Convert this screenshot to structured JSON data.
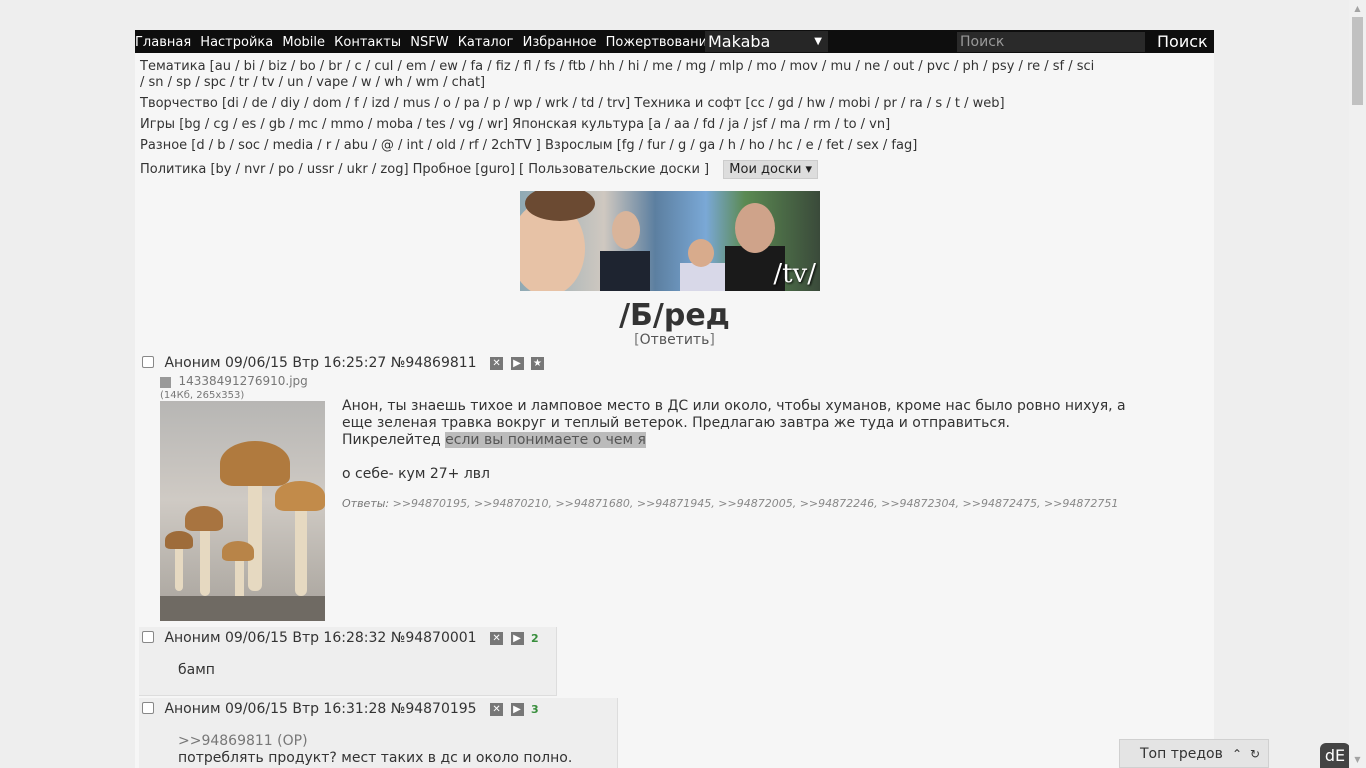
{
  "topbar": {
    "links": [
      "Главная",
      "Настройка",
      "Mobile",
      "Контакты",
      "NSFW",
      "Каталог",
      "Избранное",
      "Пожертвования"
    ],
    "style_select": "Makaba",
    "search_placeholder": "Поиск",
    "search_button": "Поиск"
  },
  "boards": {
    "rows": [
      "Тематика [au / bi / biz / bo / br / c / cul / em / ew / fa / fiz / fl / fs / ftb / hh / hi / me / mg / mlp / mo / mov / mu / ne / out / pvc / ph / psy / re / sf / sci",
      "/ sn / sp / spc / tr / tv / un / vape / w / wh / wm / chat]",
      "Творчество [di / de / diy / dom / f / izd / mus / o / pa / p / wp / wrk / td / trv]   Техника и софт [cc / gd / hw / mobi / pr / ra / s / t / web]",
      "Игры [bg / cg / es / gb / mc / mmo / moba / tes / vg / wr]   Японская культура [a / aa / fd / ja / jsf / ma / rm / to / vn]",
      "Разное [d / b / soc / media / r / abu / @ / int / old / rf / 2chTV ]   Взрослым [fg / fur / g / ga / h / ho / hc / e / fet / sex / fag]",
      "Политика [by / nvr / po / ussr / ukr / zog]   Пробное [guro]   [ Пользовательские доски ]"
    ],
    "my_boards": "Мои доски ▾"
  },
  "banner": {
    "text": "/tv/"
  },
  "board_title": "/Б/ред",
  "reply_link": {
    "open": "[",
    "label": "Ответить",
    "close": "]"
  },
  "op": {
    "header": "Аноним 09/06/15 Втр 16:25:27 №94869811",
    "file_name": "14338491276910.jpg",
    "file_size": "(14Кб, 265x353)",
    "line1": "Анон, ты знаешь тихое и ламповое место в ДС или около, чтобы хуманов, кроме нас было ровно нихуя, а",
    "line2": "еще зеленая травка вокруг и теплый ветерок. Предлагаю завтра же туда и отправиться.",
    "line3_prefix": "Пикрелейтед ",
    "line3_spoiler": "если вы понимаете о чем я",
    "line4": "о себе- кум 27+ лвл",
    "replies_label": "Ответы:",
    "replies": ">>94870195, >>94870210, >>94871680, >>94871945, >>94872005, >>94872246, >>94872304, >>94872475, >>94872751"
  },
  "posts": [
    {
      "header": "Аноним 09/06/15 Втр 16:28:32 №94870001",
      "num": "2",
      "text": "бамп"
    },
    {
      "header": "Аноним 09/06/15 Втр 16:31:28 №94870195",
      "num": "3",
      "quote": ">>94869811 (OP)",
      "text": "потреблять продукт? мест таких в дс и около полно."
    }
  ],
  "top_threads": "Топ тредов"
}
